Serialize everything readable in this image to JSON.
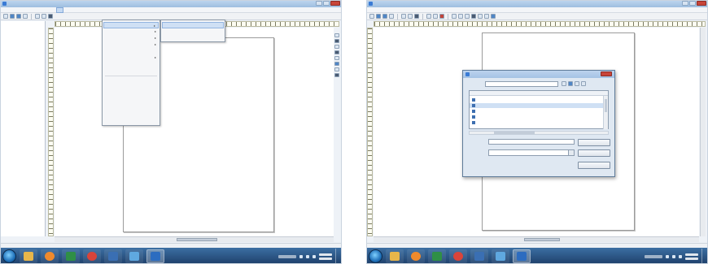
{
  "left_window": {
    "title": "",
    "menu_items": [
      "",
      "",
      "",
      "",
      "",
      "",
      "",
      ""
    ],
    "open_menu": {
      "items": [
        {
          "label": "",
          "submenu": true,
          "highlighted": true
        },
        {
          "label": "",
          "submenu": true
        },
        {
          "label": "",
          "submenu": true
        },
        {
          "label": "",
          "submenu": true
        },
        {
          "label": "",
          "submenu": false
        },
        {
          "label": "",
          "submenu": true
        },
        {
          "label": "",
          "submenu": false
        },
        {
          "label": "",
          "submenu": false
        },
        {
          "label": "",
          "submenu": false,
          "disabled": true
        },
        {
          "label": "",
          "submenu": false,
          "disabled": true
        },
        {
          "label": "",
          "submenu": false,
          "disabled": true
        },
        {
          "label": "",
          "submenu": false,
          "disabled": true
        },
        {
          "label": "",
          "submenu": false,
          "disabled": true
        },
        {
          "label": "",
          "submenu": false,
          "disabled": true
        }
      ]
    },
    "submenu": {
      "items": [
        {
          "label": "",
          "highlighted": true
        },
        {
          "label": "",
          "disabled": true
        },
        {
          "label": "",
          "disabled": true
        }
      ]
    },
    "status_text": ""
  },
  "right_window": {
    "title": "",
    "menu_items": [
      "",
      "",
      "",
      "",
      "",
      "",
      "",
      ""
    ],
    "status_text": "",
    "dialog": {
      "title": "",
      "look_in_label": "",
      "look_in_value": "",
      "columns": {
        "name": "",
        "date_modified": ""
      },
      "files": [
        {
          "name": "",
          "date": "",
          "selected": false
        },
        {
          "name": "",
          "date": "",
          "selected": true
        },
        {
          "name": "",
          "date": "",
          "selected": false
        },
        {
          "name": "",
          "date": "",
          "selected": false
        },
        {
          "name": "",
          "date": "",
          "selected": false
        }
      ],
      "file_name_label": "",
      "file_name_value": "",
      "file_type_label": "",
      "file_type_value": "",
      "open_button": "",
      "cancel_button": "",
      "extra_button": ""
    }
  },
  "taskbar": {
    "apps": [
      {
        "icon": "folder-icon",
        "color": "#e8b64a"
      },
      {
        "icon": "media-player-icon",
        "color": "#f08a2c"
      },
      {
        "icon": "excel-icon",
        "color": "#2f8f46"
      },
      {
        "icon": "chrome-icon",
        "color": "#d9443a"
      },
      {
        "icon": "photoshop-icon",
        "color": "#3a6fb3"
      },
      {
        "icon": "explorer-icon",
        "color": "#5fa8e0"
      },
      {
        "icon": "chart-app-icon",
        "color": "#2c6cc0"
      }
    ],
    "active_index": 6,
    "tray_label": "",
    "clock_time": "",
    "clock_date": ""
  },
  "colors": {
    "taskbar": "#2a5488",
    "menu_highlight": "#cfe0f4",
    "title_bar": "#a8c4e4"
  }
}
